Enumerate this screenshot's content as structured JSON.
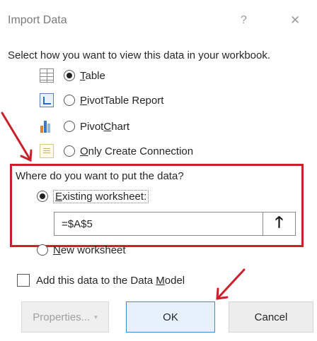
{
  "window": {
    "title": "Import Data",
    "help_glyph": "?",
    "close_glyph": "✕"
  },
  "prompt": "Select how you want to view this data in your workbook.",
  "view_options": [
    {
      "id": "table",
      "pre": "",
      "key": "T",
      "post": "able",
      "selected": true,
      "icon": "table-icon"
    },
    {
      "id": "pivottable",
      "pre": "",
      "key": "P",
      "post": "ivotTable Report",
      "selected": false,
      "icon": "pivottable-icon"
    },
    {
      "id": "pivotchart",
      "pre": "Pivot",
      "key": "C",
      "post": "hart",
      "selected": false,
      "icon": "pivotchart-icon"
    },
    {
      "id": "connection",
      "pre": "",
      "key": "O",
      "post": "nly Create Connection",
      "selected": false,
      "icon": "connection-icon"
    }
  ],
  "where": {
    "question": "Where do you want to put the data?",
    "existing": {
      "pre": "",
      "key": "E",
      "post": "xisting worksheet:",
      "selected": true
    },
    "reference": "=$A$5",
    "ref_button_glyph": "🡑",
    "new": {
      "pre": "",
      "key": "N",
      "post": "ew worksheet",
      "selected": false
    }
  },
  "data_model": {
    "pre": "Add this data to the Data ",
    "key": "M",
    "post": "odel",
    "checked": false
  },
  "buttons": {
    "properties": "Properties...",
    "properties_dropdown": "▾",
    "ok": "OK",
    "cancel": "Cancel"
  },
  "colors": {
    "annotation_red": "#c9202a",
    "ok_border": "#3c8ad8"
  }
}
